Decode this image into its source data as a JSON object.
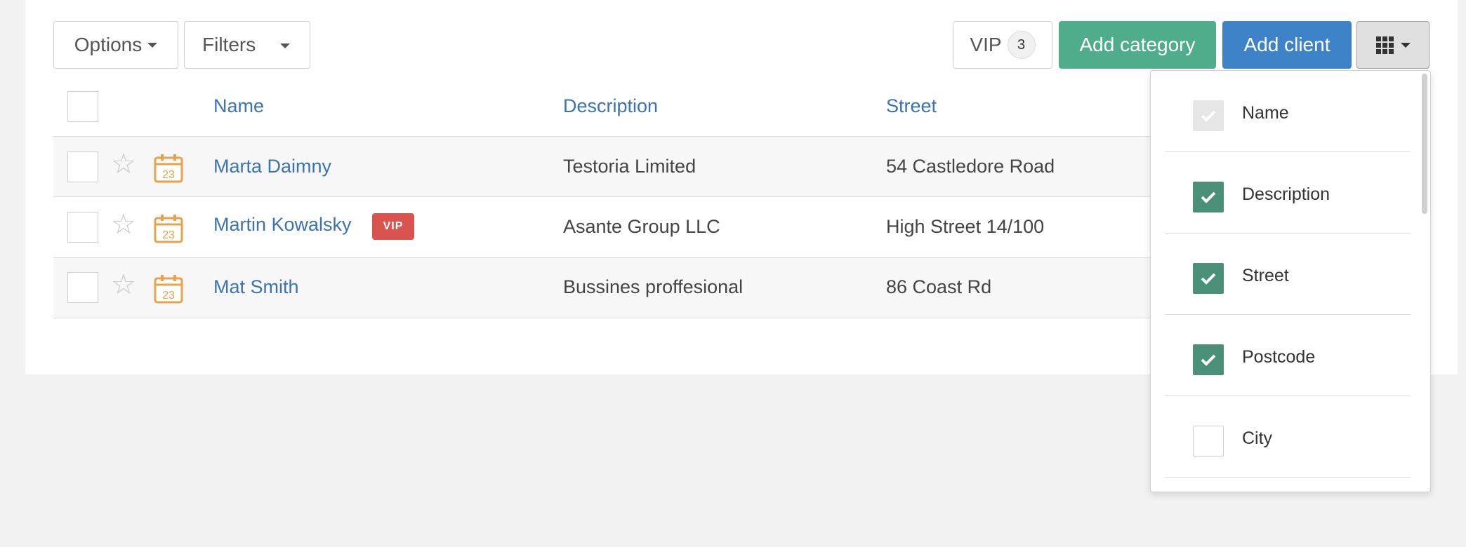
{
  "toolbar": {
    "options_label": "Options",
    "filters_label": "Filters",
    "vip_label": "VIP",
    "vip_count": "3",
    "add_category_label": "Add category",
    "add_client_label": "Add client"
  },
  "table": {
    "headers": [
      "Name",
      "Description",
      "Street"
    ],
    "rows": [
      {
        "name": "Marta Daimny",
        "description": "Testoria Limited",
        "street": "54 Castledore Road",
        "vip": false,
        "calendar_day": "23"
      },
      {
        "name": "Martin Kowalsky",
        "description": "Asante Group LLC",
        "street": "High Street 14/100",
        "vip": true,
        "vip_label": "VIP",
        "calendar_day": "23"
      },
      {
        "name": "Mat Smith",
        "description": "Bussines proffesional",
        "street": "86 Coast Rd",
        "vip": false,
        "calendar_day": "23"
      }
    ]
  },
  "columns_dropdown": {
    "items": [
      {
        "label": "Name",
        "state": "disabled"
      },
      {
        "label": "Description",
        "state": "checked"
      },
      {
        "label": "Street",
        "state": "checked"
      },
      {
        "label": "Postcode",
        "state": "checked"
      },
      {
        "label": "City",
        "state": "unchecked"
      }
    ]
  },
  "colors": {
    "accent_green": "#4fad8c",
    "accent_blue": "#3e82c8",
    "link_blue": "#3a73b0",
    "vip_red": "#d9534f",
    "calendar_orange": "#e8a24a",
    "checkbox_green": "#4a8f78"
  },
  "icons": {
    "star": "star-outline-icon",
    "calendar": "calendar-icon",
    "columns": "grid-icon",
    "check": "check-icon"
  }
}
